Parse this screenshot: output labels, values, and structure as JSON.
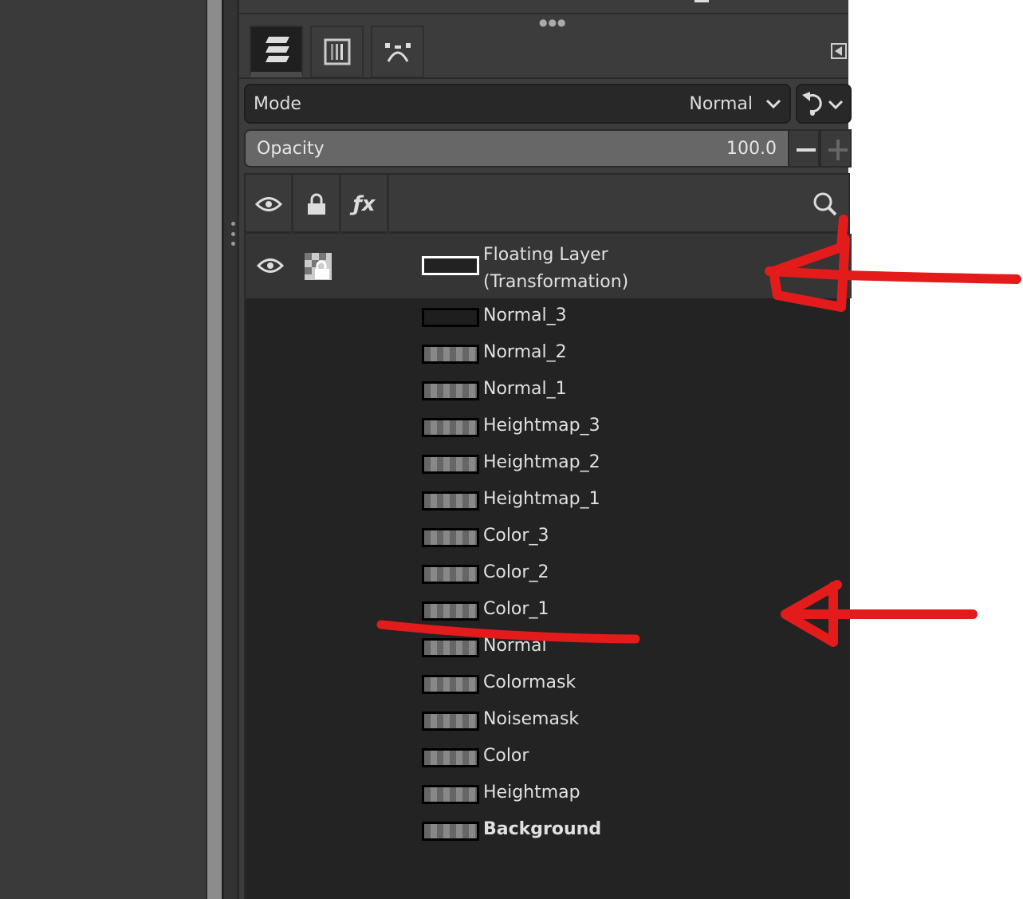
{
  "tabs": [
    {
      "name": "layers"
    },
    {
      "name": "channels"
    },
    {
      "name": "paths"
    }
  ],
  "mode": {
    "label": "Mode",
    "value": "Normal"
  },
  "opacity": {
    "label": "Opacity",
    "value": "100.0"
  },
  "header": {
    "fx_label": "ƒx"
  },
  "selected_layer": {
    "line1": "Floating Layer",
    "line2": "(Transformation)"
  },
  "layers": [
    "Normal_3",
    "Normal_2",
    "Normal_1",
    "Heightmap_3",
    "Heightmap_2",
    "Heightmap_1",
    "Color_3",
    "Color_2",
    "Color_1",
    "Normal",
    "Colormask",
    "Noisemask",
    "Color",
    "Heightmap",
    "Background"
  ],
  "annotation_color": "#e31b1b"
}
